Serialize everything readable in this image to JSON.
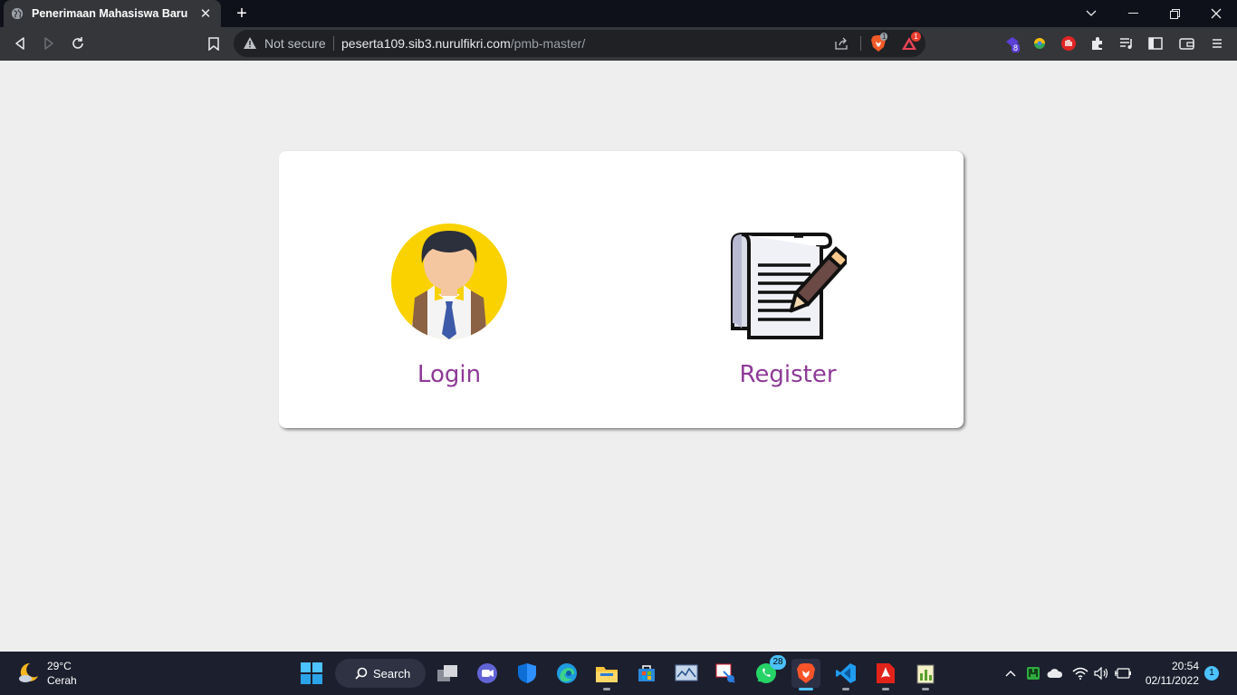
{
  "browser": {
    "tab": {
      "title": "Penerimaan Mahasiswa Baru",
      "close": "✕"
    },
    "new_tab": "+",
    "window_controls": {
      "tabsearch": "chevron-down-icon",
      "minimize": "minimize-icon",
      "maximize": "restore-icon",
      "close": "close-icon"
    },
    "address_bar": {
      "security_label": "Not secure",
      "domain": "peserta109.sib3.nurulfikri.com",
      "path": "/pmb-master/"
    },
    "extensions": {
      "brave_shields_count": "1",
      "rewards_count": "1",
      "ext1_badge": "8"
    }
  },
  "page": {
    "options": [
      {
        "label": "Login",
        "icon": "student-avatar-icon"
      },
      {
        "label": "Register",
        "icon": "document-pencil-icon"
      }
    ]
  },
  "taskbar": {
    "weather": {
      "temp": "29°C",
      "condition": "Cerah"
    },
    "search_label": "Search",
    "whatsapp_badge": "28",
    "clock": {
      "time": "20:54",
      "date": "02/11/2022"
    },
    "notifications": "1"
  },
  "colors": {
    "accent_link": "#8e3a97",
    "page_bg": "#eeeeee",
    "taskbar_accent": "#4cc2ff"
  }
}
